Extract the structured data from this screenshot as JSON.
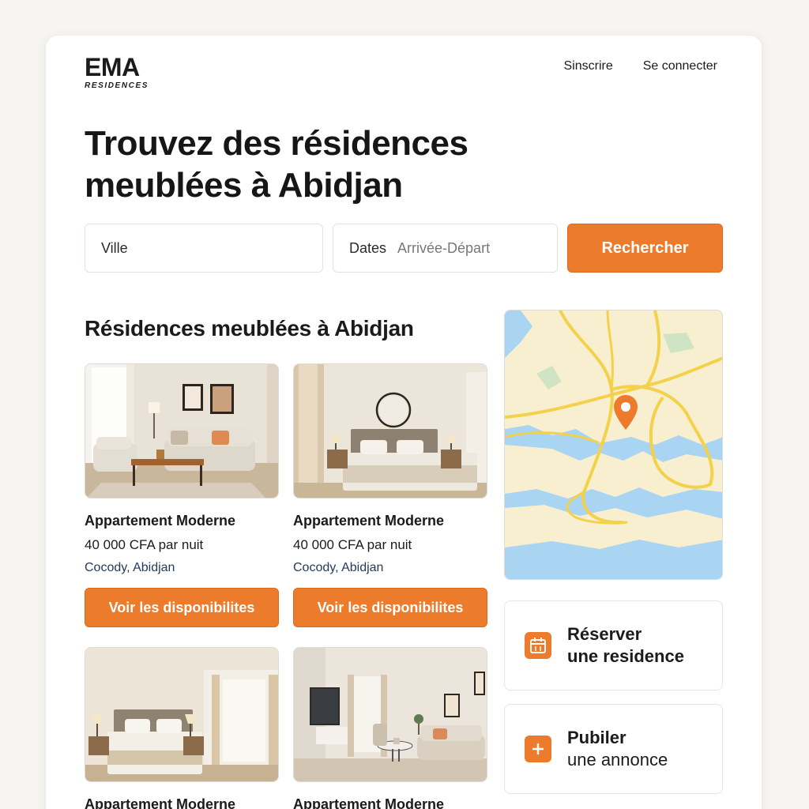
{
  "brand": {
    "name": "EMA",
    "tagline": "RESIDENCES"
  },
  "nav": {
    "signup": "Sinscrire",
    "login": "Se connecter"
  },
  "hero": {
    "title_line1": "Trouvez des résidences",
    "title_line2": "meublées à Abidjan"
  },
  "search": {
    "city_placeholder": "Ville",
    "dates_label": "Dates",
    "dates_placeholder": "Arrivée-Départ",
    "button": "Rechercher"
  },
  "section": {
    "title": "Résidences meublées à Abidjan"
  },
  "listings": [
    {
      "title": "Appartement Moderne",
      "price": "40 000 CFA par nuit",
      "location": "Cocody, Abidjan",
      "button": "Voir les disponibilites"
    },
    {
      "title": "Appartement Moderne",
      "price": "40 000 CFA par nuit",
      "location": "Cocody, Abidjan",
      "button": "Voir les disponibilites"
    },
    {
      "title": "Appartement Moderne"
    },
    {
      "title": "Appartement Moderne"
    }
  ],
  "actions": {
    "reserve_line1": "Réserver",
    "reserve_line2": "une residence",
    "publish_line1": "Pubiler",
    "publish_line2": "une annonce"
  },
  "icons": {
    "reserve": "calendar-icon",
    "publish": "plus-icon",
    "map_pin": "map-pin-icon"
  },
  "colors": {
    "accent": "#ec7b2b",
    "text": "#1b1b1b",
    "location_text": "#243a5a",
    "map_water": "#a9d4f2",
    "map_land": "#f7efd0",
    "map_road": "#f3d14a"
  }
}
